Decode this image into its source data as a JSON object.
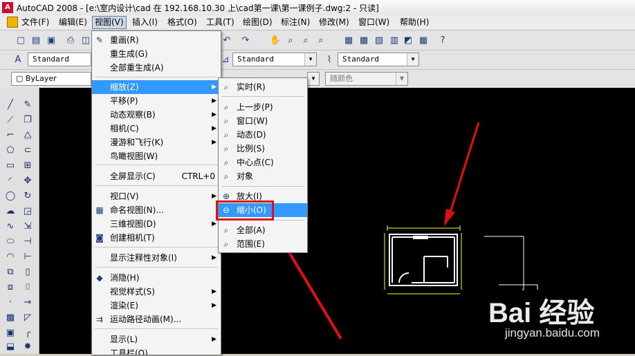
{
  "title_bar": {
    "app_icon": "A",
    "title": "AutoCAD 2008 - [e:\\室内设计\\cad 在 192.168.10.30 上\\cad第一课\\第一课例子.dwg:2 - 只读]"
  },
  "menu_bar": {
    "items": [
      "文件(F)",
      "编辑(E)",
      "视图(V)",
      "插入(I)",
      "格式(O)",
      "工具(T)",
      "绘图(D)",
      "标注(N)",
      "修改(M)",
      "窗口(W)",
      "帮助(H)"
    ],
    "active": "视图(V)"
  },
  "toolbar_styles": {
    "text_style": "Standard",
    "dim_style": "Standard",
    "table_style": "Standard"
  },
  "toolbar_properties": {
    "layer": "ByLayer",
    "color": "随颜色"
  },
  "view_menu": {
    "items": [
      {
        "label": "重画(R)",
        "icon": "pencil-icon"
      },
      {
        "label": "重生成(G)"
      },
      {
        "label": "全部重生成(A)"
      },
      {
        "label": "缩放(Z)",
        "submenu": true,
        "highlighted": true
      },
      {
        "label": "平移(P)",
        "submenu": true
      },
      {
        "label": "动态观察(B)",
        "submenu": true
      },
      {
        "label": "相机(C)",
        "submenu": true
      },
      {
        "label": "漫游和飞行(K)",
        "submenu": true
      },
      {
        "label": "鸟瞰视图(W)"
      },
      {
        "label": "全屏显示(C)",
        "shortcut": "CTRL+0"
      },
      {
        "label": "视口(V)",
        "submenu": true
      },
      {
        "label": "命名视图(N)...",
        "icon": "named-view-icon"
      },
      {
        "label": "三维视图(D)",
        "submenu": true
      },
      {
        "label": "创建相机(T)",
        "icon": "camera-icon"
      },
      {
        "label": "显示注释性对象(I)",
        "submenu": true
      },
      {
        "label": "消隐(H)",
        "icon": "hide-icon"
      },
      {
        "label": "视觉样式(S)",
        "submenu": true
      },
      {
        "label": "渲染(E)",
        "submenu": true
      },
      {
        "label": "运动路径动画(M)...",
        "icon": "motion-path-icon"
      },
      {
        "label": "显示(L)",
        "submenu": true
      },
      {
        "label": "工具栏(O)..."
      }
    ]
  },
  "zoom_submenu": {
    "items": [
      {
        "label": "实时(R)",
        "icon": "zoom-realtime-icon"
      },
      {
        "label": "上一步(P)",
        "icon": "zoom-previous-icon"
      },
      {
        "label": "窗口(W)",
        "icon": "zoom-window-icon"
      },
      {
        "label": "动态(D)",
        "icon": "zoom-dynamic-icon"
      },
      {
        "label": "比例(S)",
        "icon": "zoom-scale-icon"
      },
      {
        "label": "中心点(C)",
        "icon": "zoom-center-icon"
      },
      {
        "label": "对象",
        "icon": "zoom-object-icon"
      },
      {
        "label": "放大(I)",
        "icon": "zoom-in-icon"
      },
      {
        "label": "缩小(O)",
        "icon": "zoom-out-icon",
        "highlighted": true
      },
      {
        "label": "全部(A)",
        "icon": "zoom-all-icon"
      },
      {
        "label": "范围(E)",
        "icon": "zoom-extents-icon"
      }
    ]
  },
  "colors": {
    "highlight": "#3399ff",
    "annotation": "#e01010",
    "drawing_line": "#ffffff",
    "dimension": "#ffff00",
    "canvas": "#000000"
  },
  "watermark": {
    "logo": "Bai 经验",
    "url": "jingyan.baidu.com"
  }
}
